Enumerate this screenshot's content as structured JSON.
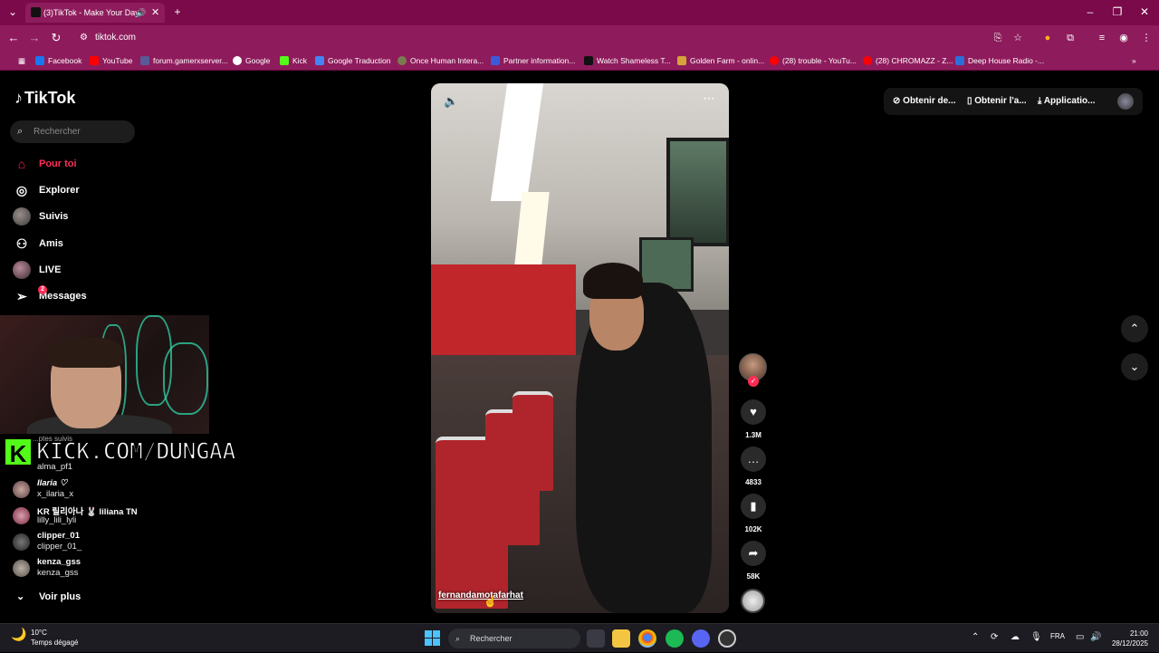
{
  "browser": {
    "tab_title": "(3)TikTok - Make Your Day",
    "url": "tiktok.com",
    "bookmarks": [
      {
        "label": "Facebook",
        "color": "#1877f2"
      },
      {
        "label": "YouTube",
        "color": "#ff0000"
      },
      {
        "label": "forum.gamerxserver...",
        "color": "#5a5a9a"
      },
      {
        "label": "Google",
        "color": "#ffffff"
      },
      {
        "label": "Kick",
        "color": "#53fc18"
      },
      {
        "label": "Google Traduction",
        "color": "#4285f4"
      },
      {
        "label": "Once Human Intera...",
        "color": "#7a7a50"
      },
      {
        "label": "Partner information...",
        "color": "#3b5bdb"
      },
      {
        "label": "Watch Shameless T...",
        "color": "#111111"
      },
      {
        "label": "Golden Farm - onlin...",
        "color": "#d6a23a"
      },
      {
        "label": "(28) trouble - YouTu...",
        "color": "#ff0000"
      },
      {
        "label": "(28) CHROMAZZ - Z...",
        "color": "#ff0000"
      },
      {
        "label": "Deep House Radio -...",
        "color": "#2a6fdb"
      }
    ]
  },
  "tiktok": {
    "logo": "TikTok",
    "search_placeholder": "Rechercher",
    "nav": [
      {
        "label": "Pour toi",
        "icon": "home-icon",
        "active": true
      },
      {
        "label": "Explorer",
        "icon": "compass-icon"
      },
      {
        "label": "Suivis",
        "icon": "avatar"
      },
      {
        "label": "Amis",
        "icon": "friends-icon"
      },
      {
        "label": "LIVE",
        "icon": "live-avatar"
      },
      {
        "label": "Messages",
        "icon": "send-icon",
        "badge": "2"
      }
    ],
    "following_partial": "...ptes suivis",
    "accounts": [
      {
        "name": "",
        "id": "alma_pf1"
      },
      {
        "name": "Ilaria ♡",
        "id": "x_ilaria_x"
      },
      {
        "name": "KR 릴리아나 🐰 liliana TN",
        "id": "lilly_lili_lyli"
      },
      {
        "name": "clipper_01",
        "id": "clipper_01_"
      },
      {
        "name": "kenza_gss",
        "id": "kenza_gss"
      }
    ],
    "see_more": "Voir plus",
    "overlay_text": "KICK.COM/DUNGAA",
    "overlay_logo": "K",
    "video": {
      "username": "fernandamotafarhat",
      "likes": "1.3M",
      "comments": "4833",
      "saves": "102K",
      "shares": "58K"
    },
    "top_right": {
      "coins": "Obtenir de...",
      "app": "Obtenir l'a...",
      "download": "Applicatio..."
    }
  },
  "taskbar": {
    "temp": "10°C",
    "weather": "Temps dégagé",
    "search": "Rechercher",
    "lang": "FRA",
    "time": "21:00",
    "date": "28/12/2025"
  }
}
